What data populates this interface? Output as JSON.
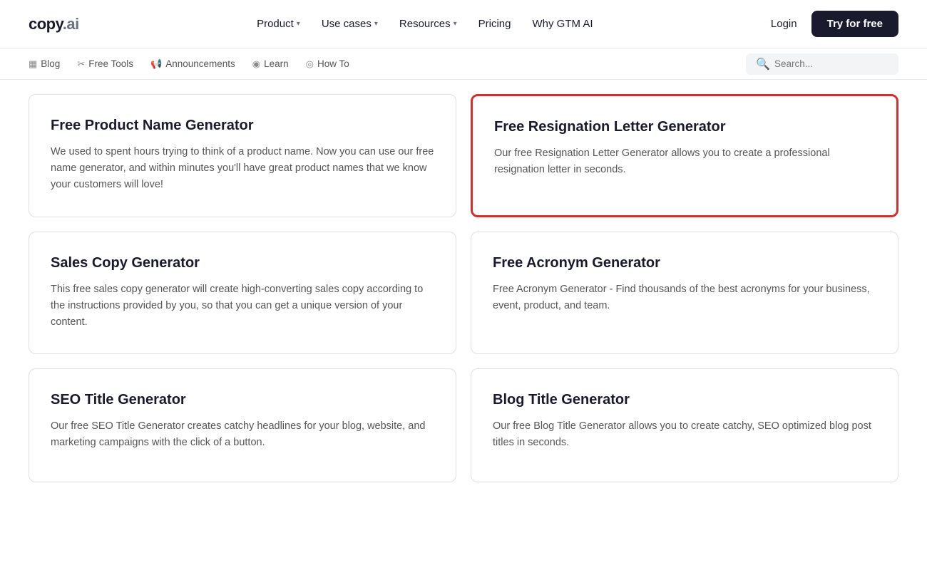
{
  "header": {
    "logo": "copy.ai",
    "nav": [
      {
        "label": "Product",
        "has_chevron": true
      },
      {
        "label": "Use cases",
        "has_chevron": true
      },
      {
        "label": "Resources",
        "has_chevron": true
      },
      {
        "label": "Pricing",
        "has_chevron": false
      },
      {
        "label": "Why GTM AI",
        "has_chevron": false
      }
    ],
    "login_label": "Login",
    "try_label": "Try for free"
  },
  "subnav": {
    "items": [
      {
        "icon": "▦",
        "label": "Blog"
      },
      {
        "icon": "✂",
        "label": "Free Tools"
      },
      {
        "icon": "📢",
        "label": "Announcements"
      },
      {
        "icon": "◉",
        "label": "Learn"
      },
      {
        "icon": "◎",
        "label": "How To"
      }
    ],
    "search_placeholder": "Search..."
  },
  "cards": [
    {
      "id": "product-name-generator",
      "title": "Free Product Name Generator",
      "desc": "We used to spent hours trying to think of a product name. Now you can use our free name generator, and within minutes you'll have great product names that we know your customers will love!",
      "highlighted": false
    },
    {
      "id": "resignation-letter-generator",
      "title": "Free Resignation Letter Generator",
      "desc": "Our free Resignation Letter Generator allows you to create a professional resignation letter in seconds.",
      "highlighted": true
    },
    {
      "id": "sales-copy-generator",
      "title": "Sales Copy Generator",
      "desc": "This free sales copy generator will create high-converting sales copy according to the instructions provided by you, so that you can get a unique version of your content.",
      "highlighted": false
    },
    {
      "id": "acronym-generator",
      "title": "Free Acronym Generator",
      "desc": "Free Acronym Generator - Find thousands of the best acronyms for your business, event, product, and team.",
      "highlighted": false
    },
    {
      "id": "seo-title-generator",
      "title": "SEO Title Generator",
      "desc": "Our free SEO Title Generator creates catchy headlines for your blog, website, and marketing campaigns with the click of a button.",
      "highlighted": false
    },
    {
      "id": "blog-title-generator",
      "title": "Blog Title Generator",
      "desc": "Our free Blog Title Generator allows you to create catchy, SEO optimized blog post titles in seconds.",
      "highlighted": false
    }
  ],
  "colors": {
    "highlight_border": "#d32f2f",
    "nav_bg": "#1a1a2e"
  }
}
